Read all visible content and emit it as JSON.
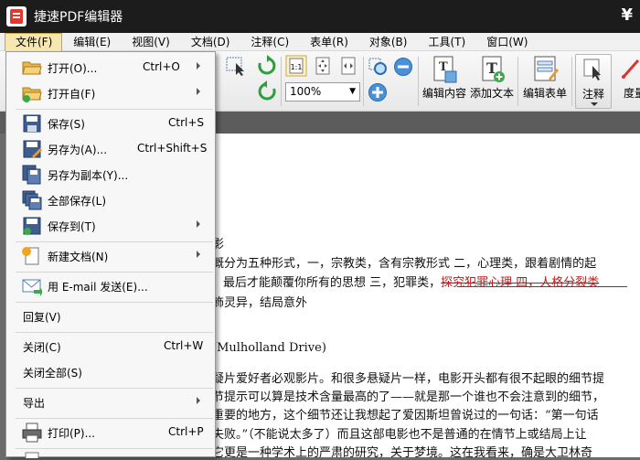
{
  "app": {
    "title": "捷速PDF编辑器"
  },
  "titlebar": {
    "right_glyph": "¥"
  },
  "menubar": {
    "items": [
      "文件(F)",
      "编辑(E)",
      "视图(V)",
      "文档(D)",
      "注释(C)",
      "表单(R)",
      "对象(B)",
      "工具(T)",
      "窗口(W)"
    ]
  },
  "toolbar": {
    "zoom_value": "100%",
    "edit_content_label": "编辑内容",
    "add_text_label": "添加文本",
    "edit_form_label": "编辑表单",
    "annotation_label": "注释",
    "partial_label": "度量"
  },
  "file_menu": {
    "open": {
      "label": "打开(O)...",
      "shortcut": "Ctrl+O"
    },
    "open_from": {
      "label": "打开自(F)"
    },
    "save": {
      "label": "保存(S)",
      "shortcut": "Ctrl+S"
    },
    "save_as": {
      "label": "另存为(A)...",
      "shortcut": "Ctrl+Shift+S"
    },
    "save_copy": {
      "label": "另存为副本(Y)..."
    },
    "save_all": {
      "label": "全部保存(L)"
    },
    "save_to": {
      "label": "保存到(T)"
    },
    "new_doc": {
      "label": "新建文档(N)"
    },
    "email": {
      "label": "用 E-mail 发送(E)..."
    },
    "revert": {
      "label": "回复(V)"
    },
    "close": {
      "label": "关闭(C)",
      "shortcut": "Ctrl+W"
    },
    "close_all": {
      "label": "关闭全部(S)"
    },
    "export": {
      "label": "导出"
    },
    "print": {
      "label": "打印(P)...",
      "shortcut": "Ctrl+P"
    }
  },
  "document": {
    "line1": "影",
    "line2": "概分为五种形式，一，宗教类，含有宗教形式 二，心理类，跟着剧情的起",
    "line3a": "最后才能颠覆你所有的思想 三，犯罪类，",
    "line3b": "探究犯罪心理 四，人格分裂类",
    "line4": "飾灵异，结局意外",
    "line5": "(Mulholland Drive)",
    "line6": "疑片爱好者必观影片。和很多悬疑片一样，电影开头都有很不起眼的细节提",
    "line7": "节提示可以算是技术含量最高的了——就是那一个谁也不会注意到的细节，",
    "line8": "重要的地方，这个细节还让我想起了爱因斯坦曾说过的一句话：“第一句话",
    "line9": "失败。”（不能说太多了）而且这部电影也不是普通的在情节上或结局上让",
    "line10": "它更是一种学术上的严肃的研究，关于梦境。这在我看来，确是大卫林奇"
  }
}
